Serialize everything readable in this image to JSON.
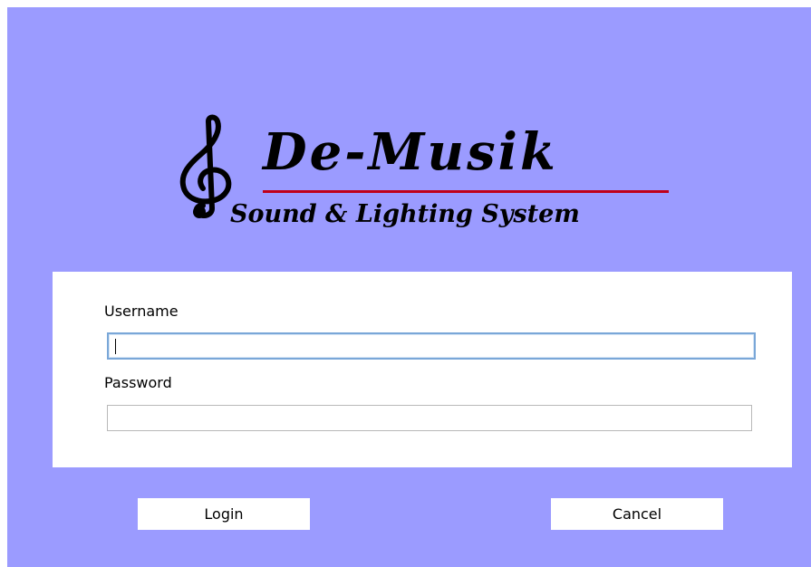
{
  "logo": {
    "brand": "De-Musik",
    "tagline": "Sound & Lighting System",
    "icon": "treble-clef-icon"
  },
  "form": {
    "username_label": "Username",
    "username_value": "",
    "password_label": "Password",
    "password_value": ""
  },
  "buttons": {
    "login_label": "Login",
    "cancel_label": "Cancel"
  },
  "colors": {
    "background": "#9b9bff",
    "panel": "#ffffff",
    "underline_accent": "#c0001a",
    "focus_border": "#7aa7d8"
  }
}
